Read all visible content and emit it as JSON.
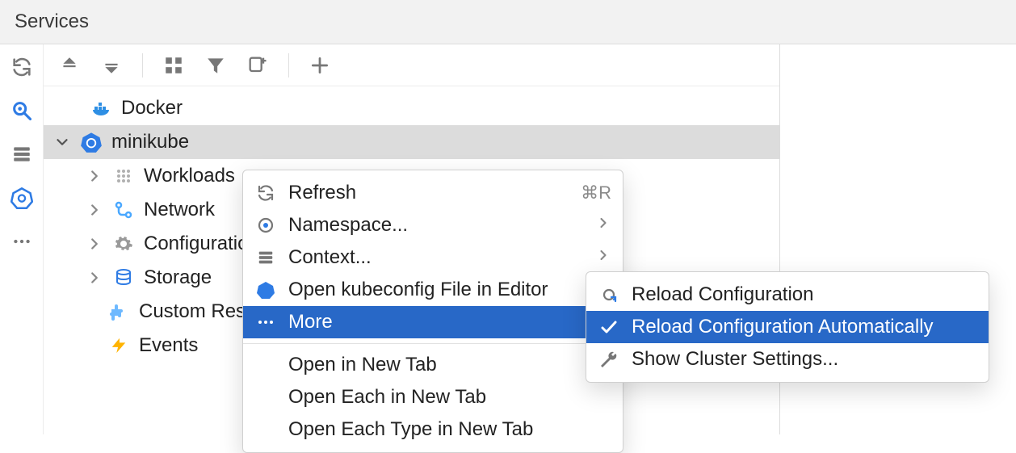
{
  "title": "Services",
  "tree": {
    "docker": "Docker",
    "minikube": "minikube",
    "children": {
      "workloads": "Workloads",
      "network": "Network",
      "configuration": "Configuration",
      "storage": "Storage",
      "crd": "Custom Resources",
      "events": "Events"
    }
  },
  "ctx": {
    "refresh": "Refresh",
    "refresh_hint": "⌘R",
    "namespace": "Namespace...",
    "context": "Context...",
    "open_kubeconfig": "Open kubeconfig File in Editor",
    "more": "More",
    "open_new_tab": "Open in New Tab",
    "open_each_new_tab": "Open Each in New Tab",
    "open_each_type_new_tab": "Open Each Type in New Tab"
  },
  "submenu": {
    "reload": "Reload Configuration",
    "reload_auto": "Reload Configuration Automatically",
    "cluster_settings": "Show Cluster Settings..."
  }
}
